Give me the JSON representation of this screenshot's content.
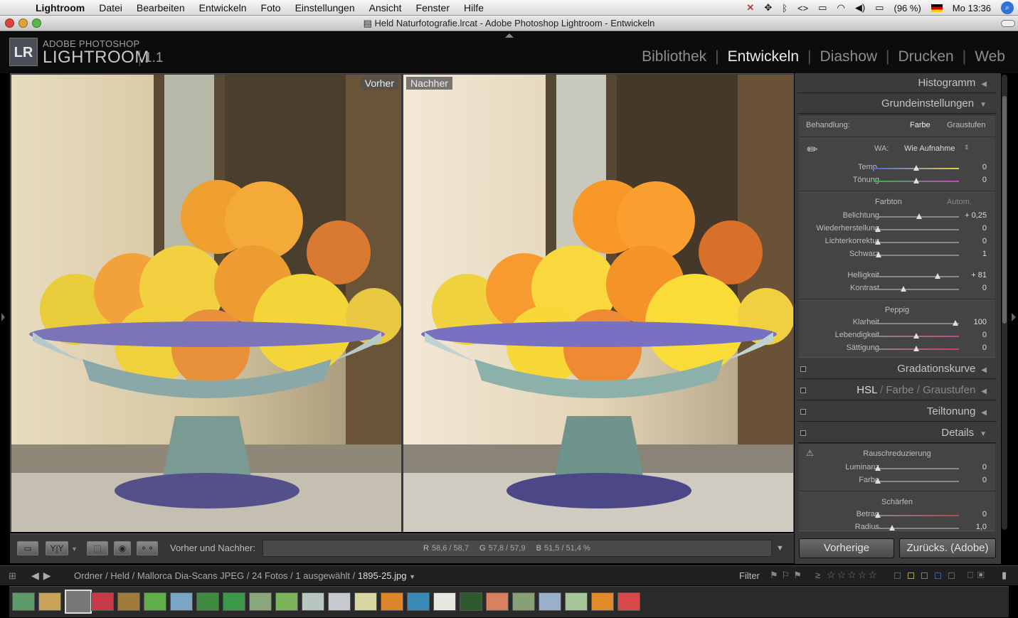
{
  "menubar": {
    "app_name": "Lightroom",
    "items": [
      "Datei",
      "Bearbeiten",
      "Entwickeln",
      "Foto",
      "Einstellungen",
      "Ansicht",
      "Fenster",
      "Hilfe"
    ],
    "battery": "(96 %)",
    "clock": "Mo 13:36"
  },
  "window": {
    "title": "Held Naturfotografie.lrcat - Adobe Photoshop Lightroom - Entwickeln"
  },
  "identity": {
    "logo": "LR",
    "brand_top": "ADOBE PHOTOSHOP",
    "brand_main": "LIGHTROOM",
    "version": "1.1"
  },
  "modules": [
    "Bibliothek",
    "Entwickeln",
    "Diashow",
    "Drucken",
    "Web"
  ],
  "active_module": "Entwickeln",
  "view": {
    "before_label": "Vorher",
    "after_label": "Nachher"
  },
  "panels": {
    "histogramm": "Histogramm",
    "grundeinstellungen": "Grundeinstellungen",
    "behandlung_label": "Behandlung:",
    "behandlung_farbe": "Farbe",
    "behandlung_graustufen": "Graustufen",
    "wa_label": "WA:",
    "wa_value": "Wie Aufnahme",
    "farbton": "Farbton",
    "autom": "Autom.",
    "peppig": "Peppig",
    "gradationskurve": "Gradationskurve",
    "hsl": "HSL",
    "hsl_farbe": "Farbe",
    "hsl_graustufen": "Graustufen",
    "teiltonung": "Teiltonung",
    "details": "Details",
    "rauschreduzierung": "Rauschreduzierung",
    "schaerfen": "Schärfen"
  },
  "sliders": {
    "temp": {
      "label": "Temp.",
      "value": "0",
      "position": 0.5
    },
    "toenung": {
      "label": "Tönung",
      "value": "0",
      "position": 0.5
    },
    "belichtung": {
      "label": "Belichtung",
      "value": "+ 0,25",
      "position": 0.53
    },
    "wiederherstellung": {
      "label": "Wiederherstellung",
      "value": "0",
      "position": 0.05
    },
    "lichterkorrektur": {
      "label": "Lichterkorrektur",
      "value": "0",
      "position": 0.05
    },
    "schwarz": {
      "label": "Schwarz",
      "value": "1",
      "position": 0.06
    },
    "helligkeit": {
      "label": "Helligkeit",
      "value": "+ 81",
      "position": 0.75
    },
    "kontrast": {
      "label": "Kontrast",
      "value": "0",
      "position": 0.35
    },
    "klarheit": {
      "label": "Klarheit",
      "value": "100",
      "position": 0.96
    },
    "lebendigkeit": {
      "label": "Lebendigkeit",
      "value": "0",
      "position": 0.5
    },
    "saettigung": {
      "label": "Sättigung",
      "value": "0",
      "position": 0.5
    },
    "luminanz": {
      "label": "Luminanz",
      "value": "0",
      "position": 0.05
    },
    "nr_farbe": {
      "label": "Farbe",
      "value": "0",
      "position": 0.05
    },
    "betrag": {
      "label": "Betrag",
      "value": "0",
      "position": 0.05
    },
    "radius": {
      "label": "Radius",
      "value": "1,0",
      "position": 0.22
    }
  },
  "toolbar": {
    "yy": "Y|Y",
    "before_after_label": "Vorher und Nachher:",
    "r_label": "R",
    "r_value": "58,6 / 58,7",
    "g_label": "G",
    "g_value": "57,8 / 57,9",
    "b_label": "B",
    "b_value": "51,5 / 51,4 %"
  },
  "buttons": {
    "previous": "Vorherige",
    "reset": "Zurücks. (Adobe)"
  },
  "filmstrip": {
    "breadcrumb": "Ordner / Held / Mallorca Dia-Scans JPEG / 24 Fotos / 1 ausgewählt / ",
    "current_file": "1895-25.jpg",
    "filter_label": "Filter",
    "rating_prefix": "≥",
    "stars": "☆☆☆☆☆",
    "color_labels": [
      "#b33a3a",
      "#b8a23a",
      "#4e9a3a",
      "#3a5ab3",
      "#8a3ab3"
    ],
    "thumbnail_colors": [
      "#5f9a6a",
      "#c9a35b",
      "#8a6a3a",
      "#c63a4a",
      "#a07a3a",
      "#5fae4a",
      "#7aa6c6",
      "#3f8a3f",
      "#3a9a4a",
      "#8aa67a",
      "#7ab35a",
      "#b8c6c0",
      "#c6cad0",
      "#d8d6a0",
      "#e0862a",
      "#3a8ab6",
      "#e8e8e0",
      "#2f5a2f",
      "#d88060",
      "#88a078",
      "#9ab0c8",
      "#a6c69a",
      "#e08a2a",
      "#d84a4a"
    ]
  }
}
